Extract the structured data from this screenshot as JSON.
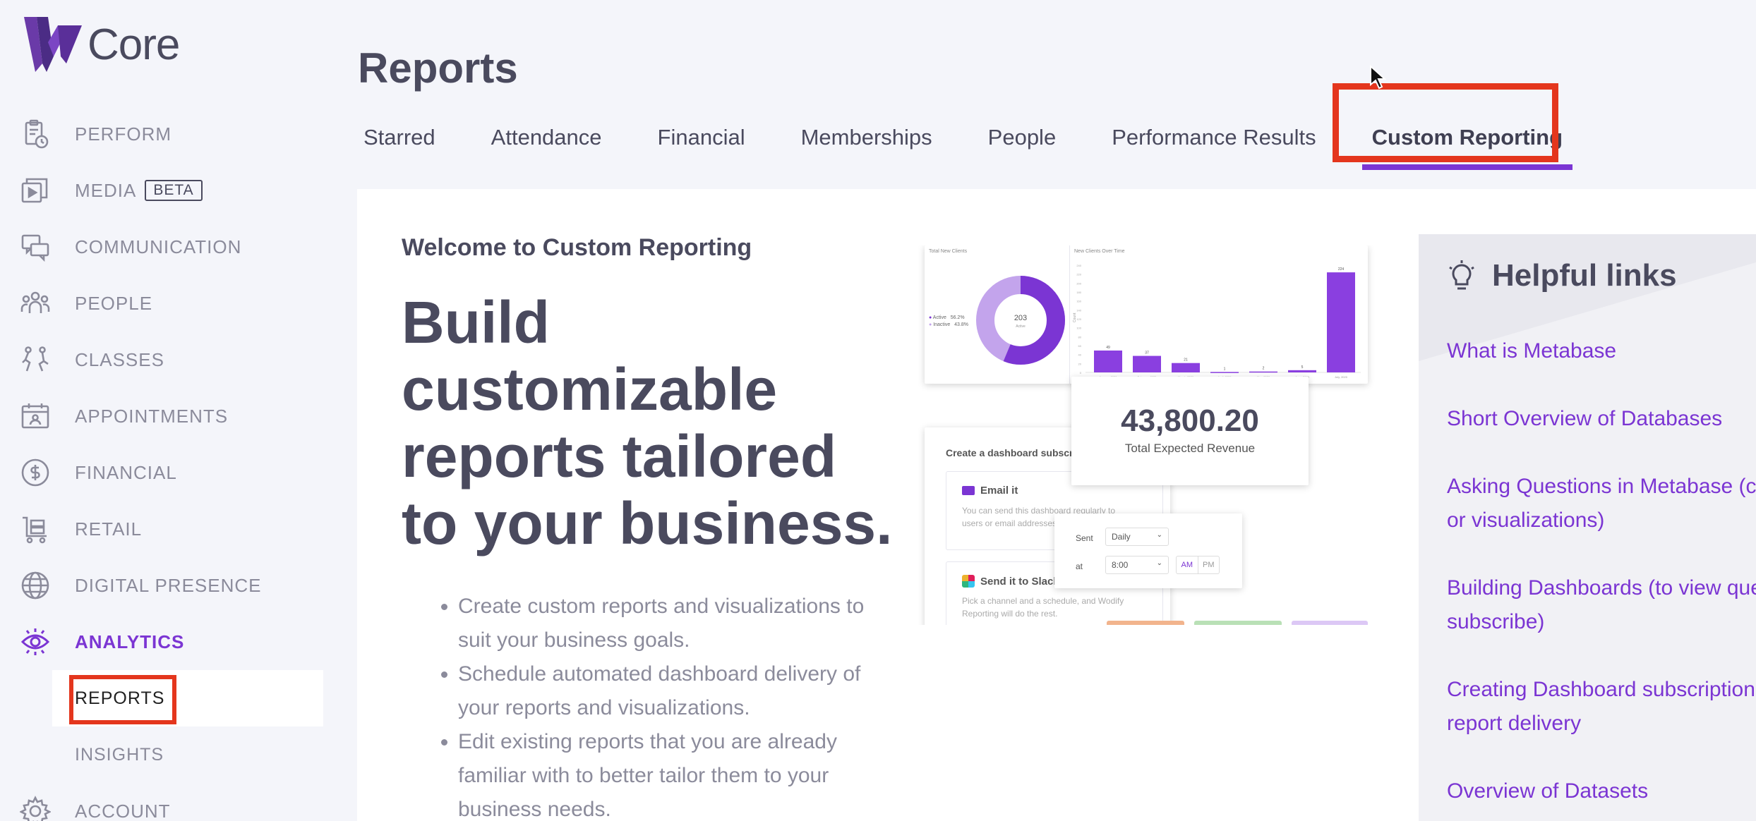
{
  "app": {
    "logo_text": "Core"
  },
  "sidebar": {
    "items": [
      {
        "label": "PERFORM",
        "icon": "clipboard-clock-icon"
      },
      {
        "label": "MEDIA",
        "badge": "BETA",
        "icon": "media-play-icon"
      },
      {
        "label": "COMMUNICATION",
        "icon": "chat-bubbles-icon"
      },
      {
        "label": "PEOPLE",
        "icon": "people-group-icon"
      },
      {
        "label": "CLASSES",
        "icon": "classes-figures-icon"
      },
      {
        "label": "APPOINTMENTS",
        "icon": "calendar-person-icon"
      },
      {
        "label": "FINANCIAL",
        "icon": "dollar-circle-icon"
      },
      {
        "label": "RETAIL",
        "icon": "cart-icon"
      },
      {
        "label": "DIGITAL PRESENCE",
        "icon": "globe-icon"
      },
      {
        "label": "ANALYTICS",
        "icon": "eye-icon",
        "active": true
      }
    ],
    "subitems": [
      {
        "label": "REPORTS",
        "selected": true
      },
      {
        "label": "INSIGHTS"
      }
    ],
    "account": {
      "label": "ACCOUNT",
      "icon": "gear-icon"
    }
  },
  "header": {
    "title": "Reports",
    "tabs": [
      {
        "label": "Starred"
      },
      {
        "label": "Attendance"
      },
      {
        "label": "Financial"
      },
      {
        "label": "Memberships"
      },
      {
        "label": "People"
      },
      {
        "label": "Performance Results"
      },
      {
        "label": "Custom Reporting",
        "active": true
      }
    ]
  },
  "main": {
    "welcome": "Welcome to Custom Reporting",
    "hero": "Build customizable reports tailored to your business.",
    "bullets": [
      "Create custom reports and visualizations to suit your business goals.",
      "Schedule automated dashboard delivery of your reports and visualizations.",
      "Edit existing reports that you are already familiar with to better tailor them to your business needs."
    ],
    "illustration": {
      "donut_title": "Total New Clients",
      "donut_center": "203",
      "donut_center_sub": "Active",
      "legend_active": "Active",
      "legend_active_pct": "56.2%",
      "legend_inactive": "Inactive",
      "legend_inactive_pct": "43.8%",
      "bar_title": "New Clients Over Time",
      "bar_ylabel": "Count",
      "bar_values": [
        49,
        37,
        21,
        1,
        2,
        5,
        224
      ],
      "bar_labels": [
        "49",
        "37",
        "21",
        "1",
        "2",
        "5",
        "224"
      ],
      "bar_categories": [
        "January, 2020",
        "February, 2020",
        "March, 2020",
        "April, 2020",
        "May, 2020",
        "June, 2020",
        "July, 2020"
      ],
      "revenue_value": "43,800.20",
      "revenue_label": "Total Expected Revenue",
      "subscription_title": "Create a dashboard subscription",
      "email_title": "Email it",
      "email_desc": "You can send this dashboard regularly to users or email addresses.",
      "slack_title": "Send it to Slack",
      "slack_desc": "Pick a channel and a schedule, and Wodify Reporting will do the rest.",
      "sent_label": "Sent",
      "sent_value": "Daily",
      "at_label": "at",
      "at_value": "8:00",
      "am": "AM",
      "pm": "PM"
    }
  },
  "helpful_links": {
    "title": "Helpful links",
    "links": [
      {
        "line1": "What is Metabase"
      },
      {
        "line1": "Short Overview of Databases"
      },
      {
        "line1": "Asking Questions in Metabase (cu",
        "line2": "or visualizations)"
      },
      {
        "line1": "Building Dashboards (to view que",
        "line2": "subscribe)"
      },
      {
        "line1": "Creating Dashboard subscription",
        "line2": "report delivery"
      },
      {
        "line1": "Overview of Datasets"
      }
    ]
  },
  "colors": {
    "accent": "#7b35d3",
    "highlight": "#e4361d",
    "text": "#4a4a5e",
    "muted": "#8b8b9b"
  }
}
